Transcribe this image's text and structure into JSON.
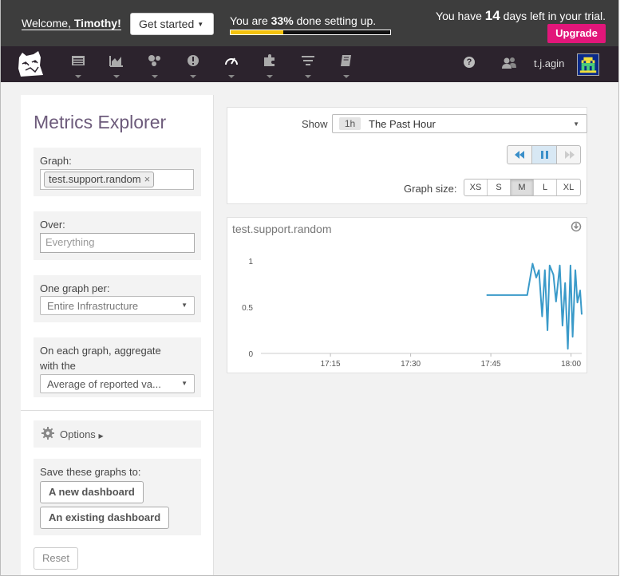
{
  "trial_bar": {
    "welcome_prefix": "Welcome,",
    "user_first_name": "Timothy!",
    "get_started_label": "Get started",
    "setup_prefix": "You are",
    "setup_percent": "33%",
    "setup_suffix": "done setting up.",
    "setup_progress_fraction": 0.33,
    "trial_prefix": "You have",
    "trial_days": "14",
    "trial_suffix": "days left in your trial.",
    "upgrade_label": "Upgrade"
  },
  "nav": {
    "icons": [
      "dashboard-icon",
      "metrics-icon",
      "infrastructure-icon",
      "monitors-icon",
      "apm-icon",
      "integrations-icon",
      "logs-icon",
      "notebooks-icon"
    ],
    "help_glyph": "?",
    "username": "t.j.agin"
  },
  "explorer": {
    "title": "Metrics Explorer",
    "graph_label": "Graph:",
    "graph_tag": "test.support.random",
    "over_label": "Over:",
    "over_placeholder": "Everything",
    "one_graph_per_label": "One graph per:",
    "one_graph_per_value": "Entire Infrastructure",
    "aggregate_label_line1": "On each graph, aggregate",
    "aggregate_label_line2": "with the",
    "aggregate_value": "Average of reported va...",
    "options_label": "Options",
    "save_label": "Save these graphs to:",
    "new_dashboard_label": "A new dashboard",
    "existing_dashboard_label": "An existing dashboard",
    "reset_label": "Reset"
  },
  "controls": {
    "show_label": "Show",
    "time_badge": "1h",
    "time_value": "The Past Hour",
    "graph_size_label": "Graph size:",
    "sizes": [
      "XS",
      "S",
      "M",
      "L",
      "XL"
    ],
    "active_size": "M"
  },
  "colors": {
    "accent_purple": "#6d5b7b",
    "nav_bg": "#2c232d",
    "trial_bg": "#3d3d3d",
    "upgrade_pink": "#e2167a",
    "progress_yellow": "#f4c20d",
    "series_blue": "#3a9ac9"
  },
  "chart_data": {
    "type": "line",
    "title": "test.support.random",
    "xlabel": "",
    "ylabel": "",
    "x_ticks": [
      "17:15",
      "17:30",
      "17:45",
      "18:00"
    ],
    "y_ticks": [
      "0",
      "0.5",
      "1"
    ],
    "ylim": [
      0,
      1
    ],
    "x_unit": "minutes since 17:00",
    "xlim": [
      2,
      62
    ],
    "series": [
      {
        "name": "test.support.random",
        "x": [
          44.2,
          51.8,
          52.8,
          53.5,
          54.0,
          54.6,
          55.1,
          55.6,
          56.0,
          56.7,
          57.2,
          57.9,
          58.4,
          58.9,
          59.4,
          59.9,
          60.3,
          60.8,
          61.2,
          61.7,
          62.0
        ],
        "values": [
          0.63,
          0.63,
          0.97,
          0.82,
          0.9,
          0.4,
          0.9,
          0.25,
          0.95,
          0.85,
          0.56,
          0.95,
          0.3,
          0.76,
          0.05,
          0.95,
          0.18,
          0.9,
          0.55,
          0.68,
          0.42
        ]
      }
    ]
  }
}
